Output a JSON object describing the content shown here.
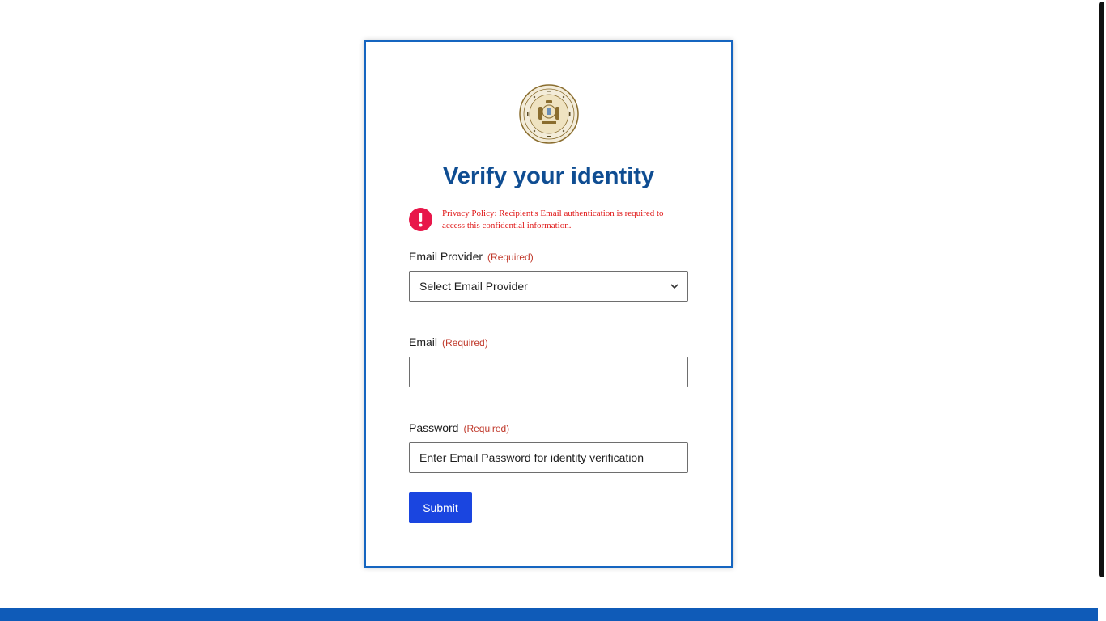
{
  "form": {
    "title": "Verify your identity",
    "notice": "Privacy Policy: Recipient's Email authentication is required to access this confidential information.",
    "email_provider": {
      "label": "Email Provider",
      "required": "(Required)",
      "selected": "Select Email Provider"
    },
    "email": {
      "label": "Email",
      "required": "(Required)",
      "value": ""
    },
    "password": {
      "label": "Password",
      "required": "(Required)",
      "placeholder": "Enter Email Password for identity verification"
    },
    "submit_label": "Submit"
  },
  "icons": {
    "seal": "state-seal-icon",
    "alert": "exclamation-circle-icon",
    "select": "chevron-down-icon"
  },
  "colors": {
    "title": "#0f4d92",
    "alert": "#e8174a",
    "required": "#c0392b",
    "submit": "#1a45e0",
    "footer": "#0f5bb8",
    "card_border": "#1565c0"
  }
}
